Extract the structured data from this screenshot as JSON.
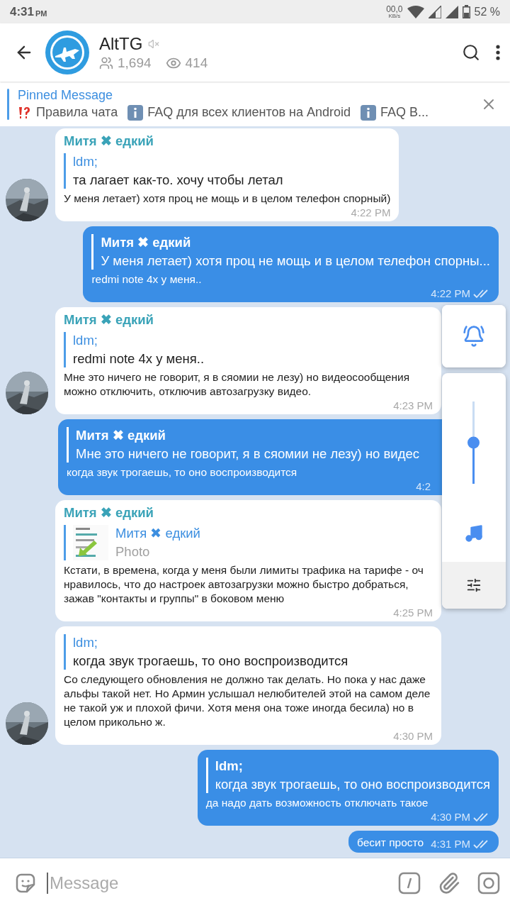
{
  "status_bar": {
    "time": "4:31",
    "ampm": "PM",
    "speed": "00,0",
    "speed_unit": "KB/s",
    "battery": "52 %"
  },
  "header": {
    "title": "AltTG",
    "muted": true,
    "members": "1,694",
    "online": "414"
  },
  "pinned": {
    "title": "Pinned Message",
    "items": [
      {
        "kind": "warning",
        "text": "Правила чата"
      },
      {
        "kind": "info",
        "text": "FAQ для всех клиентов на Android"
      },
      {
        "kind": "info",
        "text": "FAQ В..."
      }
    ]
  },
  "messages": [
    {
      "kind": "incoming",
      "avatar": true,
      "sender": "Митя ✖ едкий",
      "reply": {
        "author": "ldm;",
        "text": "та лагает как-то. хочу чтобы летал"
      },
      "text": "У меня летает) хотя проц не мощь и в целом телефон спорный)",
      "time": "4:22 PM"
    },
    {
      "kind": "outgoing",
      "reply": {
        "author": "Митя ✖ едкий",
        "text": "У меня летает) хотя проц не мощь и в целом телефон спорны..."
      },
      "text": "redmi note 4x у меня..",
      "time": "4:22 PM",
      "read": true
    },
    {
      "kind": "incoming",
      "avatar": true,
      "sender": "Митя ✖ едкий",
      "reply": {
        "author": "ldm;",
        "text": "redmi note 4x у меня.."
      },
      "text": "Мне это ничего не говорит, я в сяомии не лезу) но видеосообщения можно отключить, отключив автозагрузку видео.",
      "time": "4:23 PM"
    },
    {
      "kind": "outgoing",
      "under_panel": true,
      "reply": {
        "author": "Митя ✖ едкий",
        "text": "Мне это ничего не говорит, я в сяомии не лезу) но видес"
      },
      "text": "когда звук трогаешь, то оно воспроизводится",
      "time": "4:2"
    },
    {
      "kind": "incoming",
      "avatar": false,
      "sender": "Митя ✖ едкий",
      "reply": {
        "author": "Митя ✖ едкий",
        "text": "Photo",
        "photo": true
      },
      "text": "Кстати, в времена, когда у меня были лимиты трафика на тарифе - оч нравилось, что до настроек автозагрузки можно быстро добраться, зажав \"контакты и группы\" в боковом меню",
      "time": "4:25 PM"
    },
    {
      "kind": "incoming",
      "avatar": true,
      "reply": {
        "author": "ldm;",
        "text": "когда звук трогаешь, то оно воспроизводится"
      },
      "text": "Со следующего обновления не должно так делать. Но пока у нас даже альфы такой нет. Но Армин услышал нелюбителей этой на самом деле не такой уж и плохой фичи. Хотя меня она тоже иногда бесила) но в целом прикольно ж.",
      "time": "4:30 PM"
    },
    {
      "kind": "outgoing",
      "reply": {
        "author": "ldm;",
        "text": "когда звук трогаешь, то оно воспроизводится"
      },
      "text": "да надо дать возможность отключать такое",
      "time": "4:30 PM",
      "read": true
    },
    {
      "kind": "outgoing",
      "text": "бесит просто",
      "time": "4:31 PM",
      "read": true
    }
  ],
  "volume_panel": {
    "level": 0.5
  },
  "composer": {
    "placeholder": "Message"
  }
}
